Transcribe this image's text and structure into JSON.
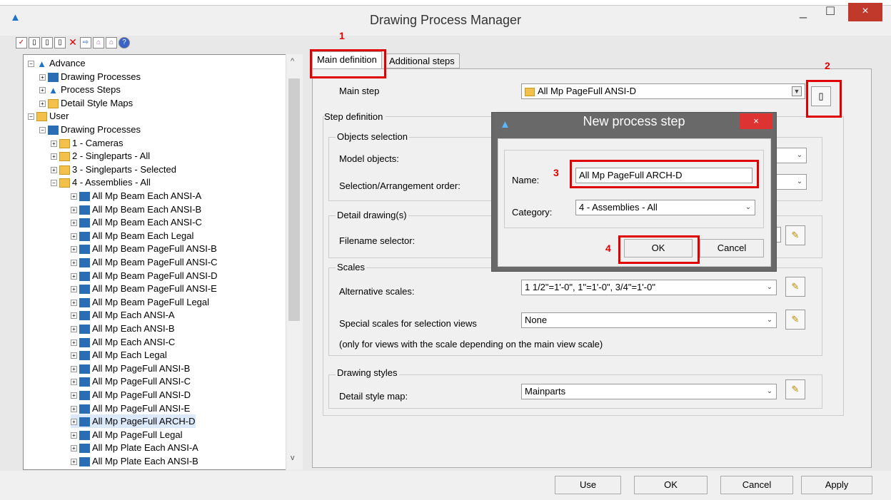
{
  "window": {
    "title": "Drawing Process Manager",
    "minimize": "_",
    "maximize": "☐",
    "close": "×"
  },
  "toolbar": {
    "icons": [
      "new-icon",
      "open-icon",
      "copy-icon",
      "paste-icon",
      "delete-icon",
      "export-icon",
      "import-icon",
      "import2-icon",
      "help-icon"
    ]
  },
  "tree": {
    "items": [
      {
        "label": "Advance",
        "level": 0,
        "icon": "adv",
        "pm": "−"
      },
      {
        "label": "Drawing Processes",
        "level": 1,
        "icon": "proc",
        "pm": "+"
      },
      {
        "label": "Process Steps",
        "level": 1,
        "icon": "adv",
        "pm": "+"
      },
      {
        "label": "Detail Style Maps",
        "level": 1,
        "icon": "fold",
        "pm": "+"
      },
      {
        "label": "User",
        "level": 0,
        "icon": "fold",
        "pm": "−"
      },
      {
        "label": "Drawing Processes",
        "level": 1,
        "icon": "proc",
        "pm": "−"
      },
      {
        "label": "1 - Cameras",
        "level": 2,
        "icon": "fold",
        "pm": "+"
      },
      {
        "label": "2 - Singleparts - All",
        "level": 2,
        "icon": "fold",
        "pm": "+"
      },
      {
        "label": "3 - Singleparts - Selected",
        "level": 2,
        "icon": "fold",
        "pm": "+"
      },
      {
        "label": "4 - Assemblies - All",
        "level": 2,
        "icon": "fold",
        "pm": "−"
      },
      {
        "label": "All Mp Beam Each ANSI-A",
        "level": 3,
        "icon": "proc",
        "pm": "+"
      },
      {
        "label": "All Mp Beam Each ANSI-B",
        "level": 3,
        "icon": "proc",
        "pm": "+"
      },
      {
        "label": "All Mp Beam Each ANSI-C",
        "level": 3,
        "icon": "proc",
        "pm": "+"
      },
      {
        "label": "All Mp Beam Each Legal",
        "level": 3,
        "icon": "proc",
        "pm": "+"
      },
      {
        "label": "All Mp Beam PageFull ANSI-B",
        "level": 3,
        "icon": "proc",
        "pm": "+"
      },
      {
        "label": "All Mp Beam PageFull ANSI-C",
        "level": 3,
        "icon": "proc",
        "pm": "+"
      },
      {
        "label": "All Mp Beam PageFull ANSI-D",
        "level": 3,
        "icon": "proc",
        "pm": "+"
      },
      {
        "label": "All Mp Beam PageFull ANSI-E",
        "level": 3,
        "icon": "proc",
        "pm": "+"
      },
      {
        "label": "All Mp Beam PageFull Legal",
        "level": 3,
        "icon": "proc",
        "pm": "+"
      },
      {
        "label": "All Mp Each ANSI-A",
        "level": 3,
        "icon": "proc",
        "pm": "+"
      },
      {
        "label": "All Mp Each ANSI-B",
        "level": 3,
        "icon": "proc",
        "pm": "+"
      },
      {
        "label": "All Mp Each ANSI-C",
        "level": 3,
        "icon": "proc",
        "pm": "+"
      },
      {
        "label": "All Mp Each Legal",
        "level": 3,
        "icon": "proc",
        "pm": "+"
      },
      {
        "label": "All Mp PageFull ANSI-B",
        "level": 3,
        "icon": "proc",
        "pm": "+"
      },
      {
        "label": "All Mp PageFull ANSI-C",
        "level": 3,
        "icon": "proc",
        "pm": "+"
      },
      {
        "label": "All Mp PageFull ANSI-D",
        "level": 3,
        "icon": "proc",
        "pm": "+"
      },
      {
        "label": "All Mp PageFull ANSI-E",
        "level": 3,
        "icon": "proc",
        "pm": "+"
      },
      {
        "label": "All Mp PageFull ARCH-D",
        "level": 3,
        "icon": "proc",
        "pm": "+",
        "selected": true
      },
      {
        "label": "All Mp PageFull Legal",
        "level": 3,
        "icon": "proc",
        "pm": "+"
      },
      {
        "label": "All Mp Plate Each ANSI-A",
        "level": 3,
        "icon": "proc",
        "pm": "+"
      },
      {
        "label": "All Mp Plate Each ANSI-B",
        "level": 3,
        "icon": "proc",
        "pm": "+"
      }
    ]
  },
  "tabs": {
    "main": "Main definition",
    "additional": "Additional steps"
  },
  "form": {
    "main_step_label": "Main step",
    "main_step_value": "All Mp PageFull ANSI-D",
    "step_definition": "Step definition",
    "objects_selection": "Objects selection",
    "model_objects": "Model objects:",
    "selection_order": "Selection/Arrangement order:",
    "detail_drawings": "Detail drawing(s)",
    "filename_selector": "Filename selector:",
    "scales": "Scales",
    "alternative_scales": "Alternative scales:",
    "alternative_scales_value": "1 1/2\"=1'-0\", 1\"=1'-0\", 3/4\"=1'-0\"",
    "special_scales": "Special scales for selection views",
    "special_scales_value": "None",
    "special_note": "(only for views with the scale depending on the main view scale)",
    "drawing_styles": "Drawing styles",
    "detail_style_map": "Detail style map:",
    "detail_style_map_value": "Mainparts"
  },
  "dialog": {
    "title": "New process step",
    "close": "×",
    "name_label": "Name:",
    "name_value": "All Mp PageFull ARCH-D",
    "category_label": "Category:",
    "category_value": "4 - Assemblies - All",
    "ok": "OK",
    "cancel": "Cancel"
  },
  "annotations": {
    "n1": "1",
    "n2": "2",
    "n3": "3",
    "n4": "4",
    "color": "#e00000"
  },
  "buttons": {
    "use": "Use",
    "ok": "OK",
    "cancel": "Cancel",
    "apply": "Apply"
  }
}
